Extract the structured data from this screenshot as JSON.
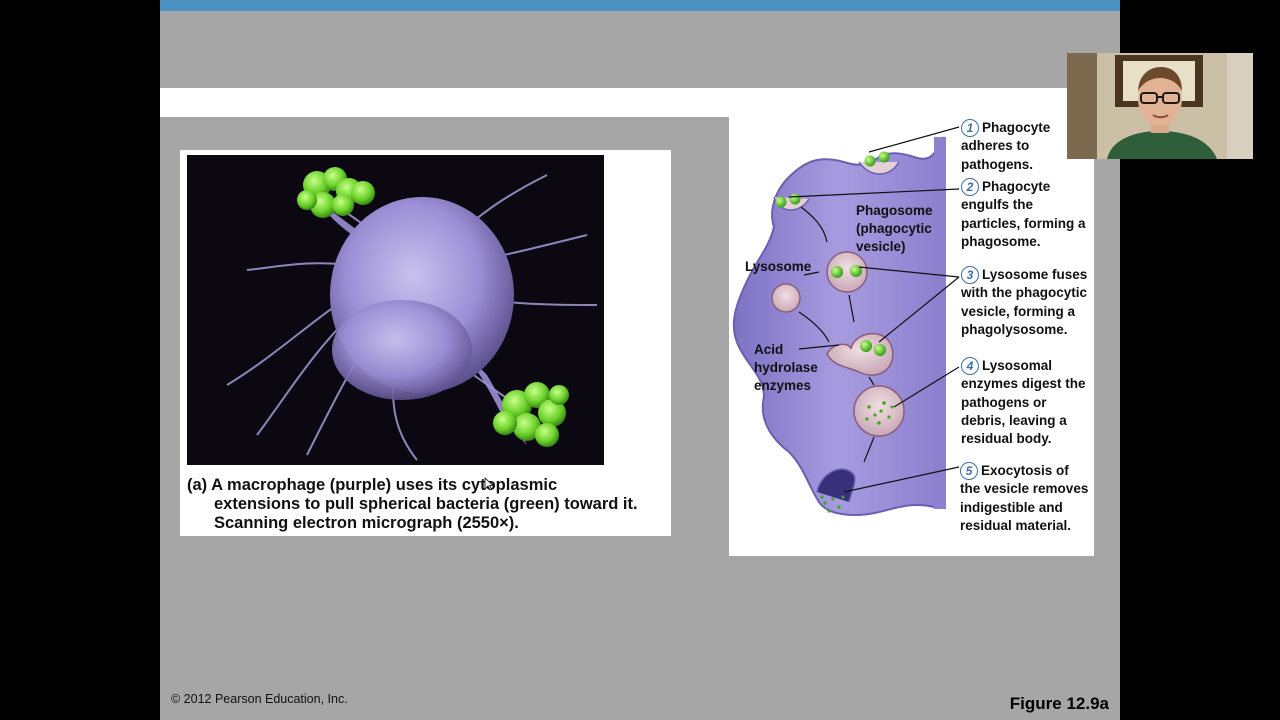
{
  "colors": {
    "topbar": "#4a90c0",
    "slide_bg": "#a6a6a6",
    "cell_purple": "#9b8fd6",
    "bacteria_green": "#6bd12a",
    "step_circle": "#3d6fa8"
  },
  "sem": {
    "caption_lead": "(a) A macrophage (purple) uses its cytoplasmic",
    "caption_rest": "extensions to pull spherical bacteria (green) toward it. Scanning electron micrograph (2550×)."
  },
  "diagram": {
    "labels": {
      "phagosome": "Phagosome (phagocytic vesicle)",
      "lysosome": "Lysosome",
      "acid": "Acid hydrolase enzymes"
    },
    "steps": [
      {
        "num": "1",
        "text": "Phagocyte adheres to pathogens."
      },
      {
        "num": "2",
        "text": "Phagocyte engulfs the particles, forming a phagosome."
      },
      {
        "num": "3",
        "text": "Lysosome fuses with the phagocytic vesicle, forming a phagolysosome."
      },
      {
        "num": "4",
        "text": "Lysosomal enzymes digest the pathogens or debris, leaving a residual body."
      },
      {
        "num": "5",
        "text": "Exocytosis of the vesicle removes indigestible and residual material."
      }
    ]
  },
  "footer": {
    "copyright": "© 2012 Pearson Education, Inc.",
    "figure": "Figure 12.9a"
  }
}
